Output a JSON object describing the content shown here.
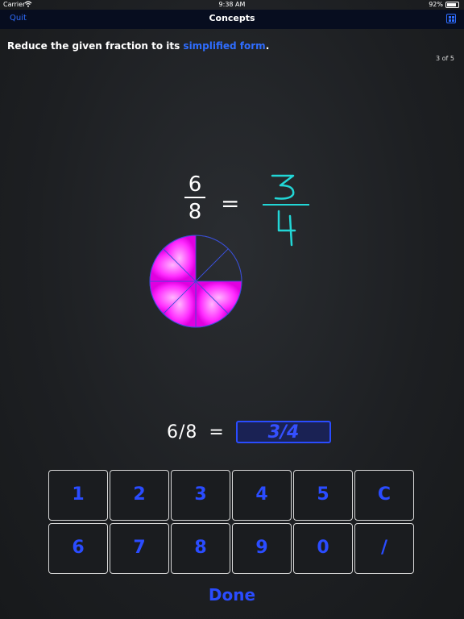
{
  "status": {
    "carrier": "Carrier",
    "time": "9:38 AM",
    "battery": "92%"
  },
  "nav": {
    "quit": "Quit",
    "title": "Concepts"
  },
  "instruction": {
    "text": "Reduce the given fraction to its ",
    "highlight": "simplified form",
    "end": "."
  },
  "progress": "3 of 5",
  "problem": {
    "numerator": "6",
    "denominator": "8",
    "equals": "=",
    "answer_num": "3",
    "answer_den": "4"
  },
  "pie": {
    "slices": 8,
    "filled": 6,
    "fill_color": "#ff00ff",
    "stroke_color": "#3a4fd6"
  },
  "equation": {
    "left": "6/8",
    "equals": "=",
    "answer": "3/4"
  },
  "keypad": {
    "row1": [
      "1",
      "2",
      "3",
      "4",
      "5",
      "C"
    ],
    "row2": [
      "6",
      "7",
      "8",
      "9",
      "0",
      "/"
    ]
  },
  "done_label": "Done",
  "colors": {
    "accent": "#2a4cff",
    "handwriting": "#22d6d6",
    "nav_bg": "#070d1f"
  }
}
